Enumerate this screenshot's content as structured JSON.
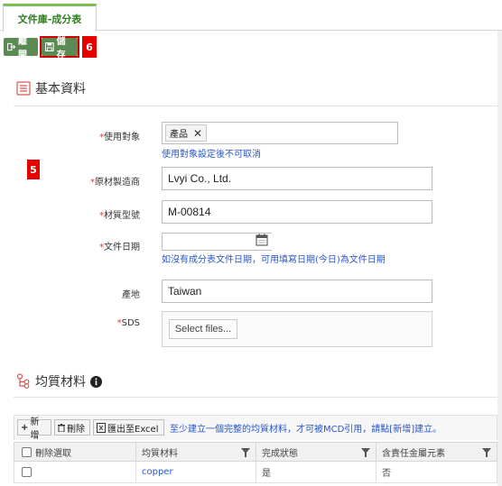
{
  "tab": {
    "label": "文件庫-成分表"
  },
  "toolbar": {
    "leave_label": "離開",
    "save_label": "儲存",
    "save_marker": "6"
  },
  "form_marker": "5",
  "basic_section": {
    "title": "基本資料"
  },
  "fields": {
    "target": {
      "label": "使用對象",
      "tag": "產品",
      "tag_remove": "✕",
      "hint": "使用對象設定後不可取消"
    },
    "manufacturer": {
      "label": "原材製造商",
      "value": "Lvyi Co., Ltd."
    },
    "model": {
      "label": "材質型號",
      "value": "M-00814"
    },
    "doc_date": {
      "label": "文件日期",
      "value": "",
      "hint": "如沒有成分表文件日期，可用填寫日期(今日)為文件日期"
    },
    "origin": {
      "label": "產地",
      "value": "Taiwan"
    },
    "sds": {
      "label": "SDS",
      "button": "Select files..."
    }
  },
  "material_section": {
    "title": "均質材料"
  },
  "grid_toolbar": {
    "add_label": "新增",
    "delete_label": "刪除",
    "export_label": "匯出至Excel",
    "notice": "至少建立一個完整的均質材料，才可被MCD引用，請點[新增]建立。"
  },
  "grid": {
    "columns": [
      "刪除選取",
      "均質材料",
      "完成狀態",
      "含責任金屬元素"
    ],
    "rows": [
      {
        "material": "copper",
        "status": "是",
        "metal": "否"
      }
    ]
  },
  "colors": {
    "accent": "#5b8a54",
    "tab_border": "#7cbf55",
    "required": "#e0393e",
    "link": "#2a56c6",
    "marker": "#e60000"
  }
}
